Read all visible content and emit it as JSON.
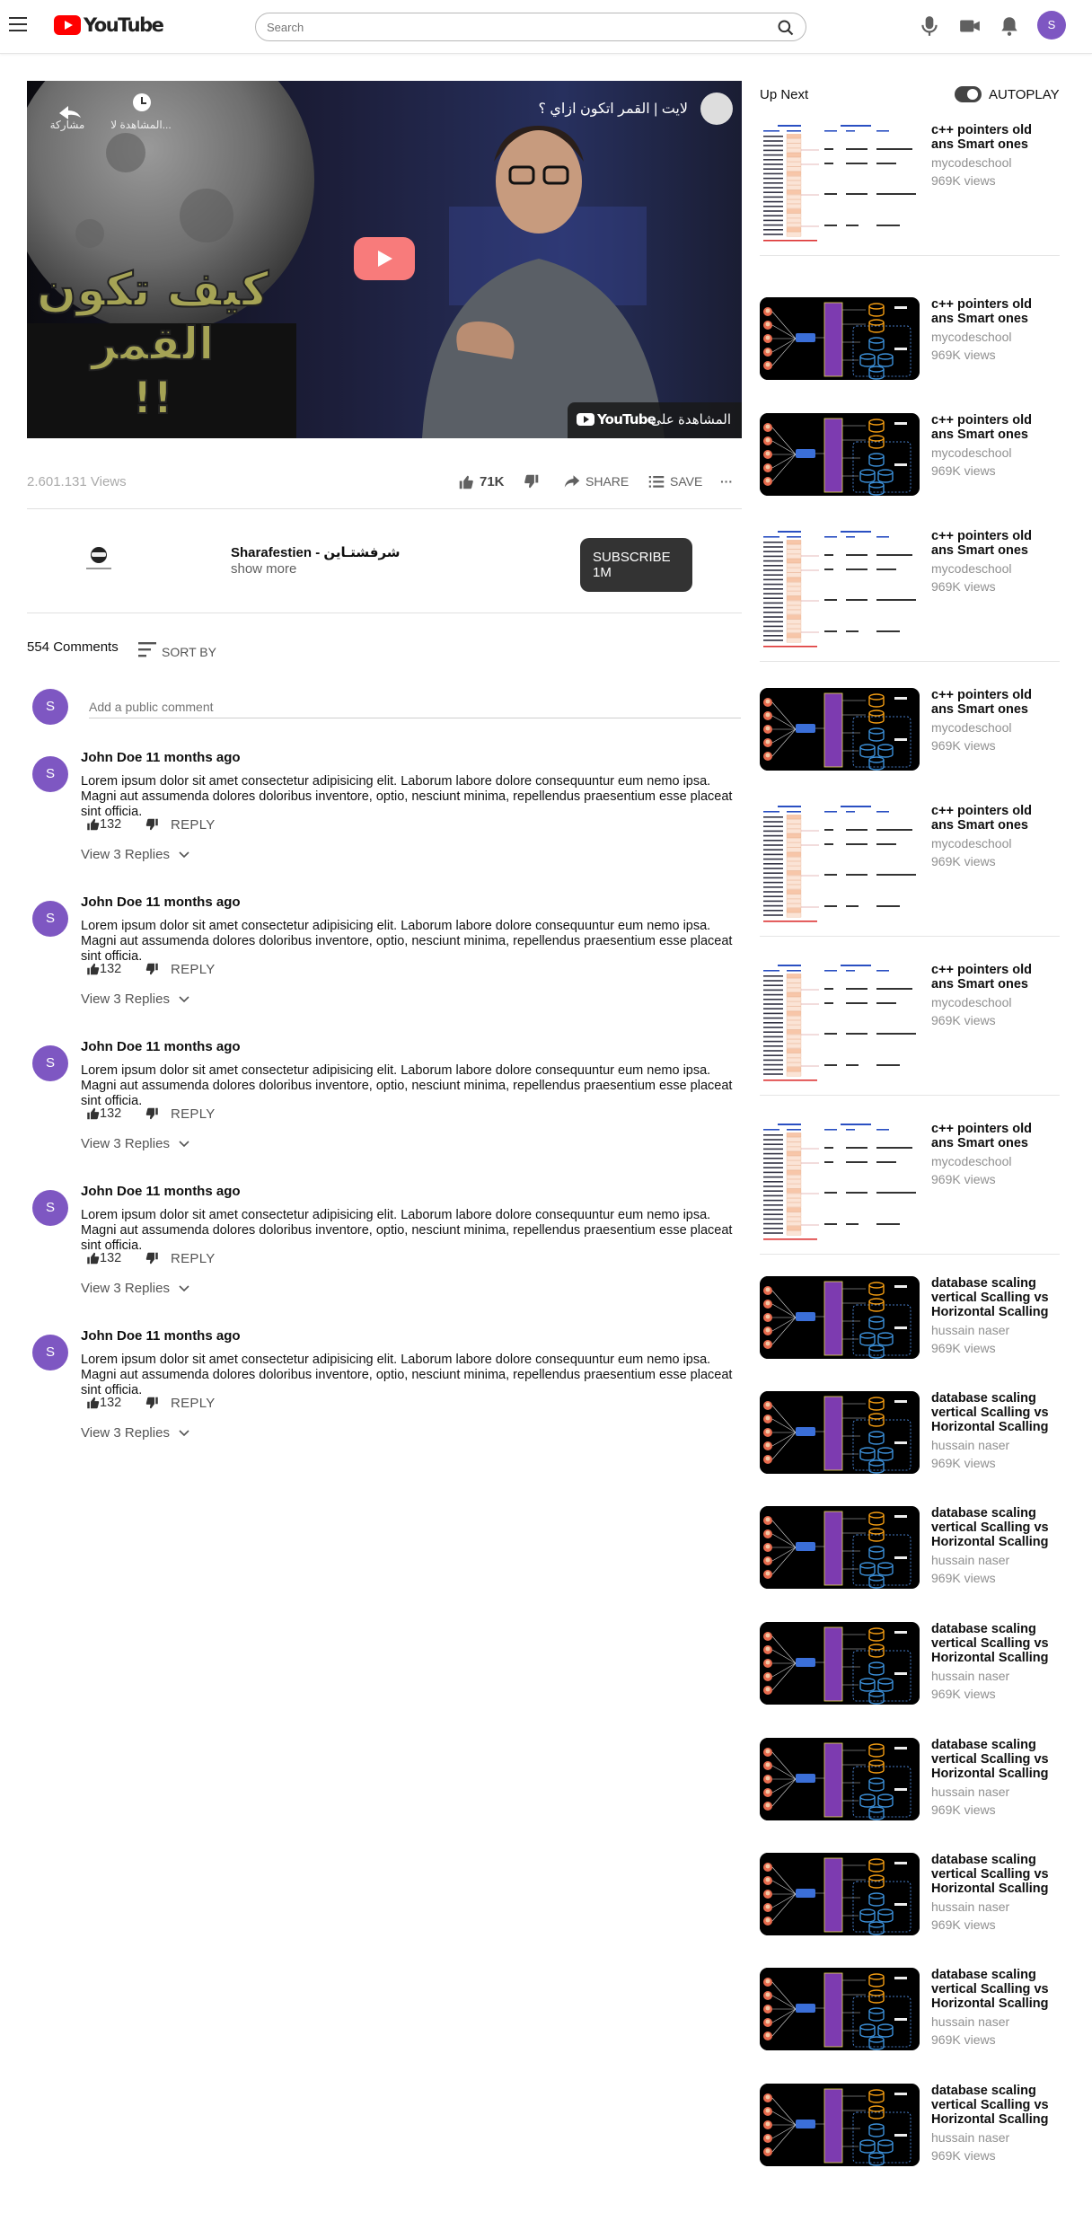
{
  "header": {
    "logo_text": "YouTube",
    "search_placeholder": "Search",
    "avatar_letter": "S"
  },
  "player": {
    "title": "لايت | القمر اتكون ازاي ؟",
    "share_label": "مشاركة",
    "watch_later_label": "المشاهدة لا...",
    "watch_on_label": "المشاهدة على",
    "watch_on_brand": "YouTube",
    "thumbnail_text_line1": "كيف تكون",
    "thumbnail_text_line2": "القمر",
    "thumbnail_text_line3": "!!"
  },
  "stats": {
    "views": "2.601.131 Views",
    "likes": "71K",
    "share_label": "SHARE",
    "save_label": "SAVE",
    "more_label": "···"
  },
  "channel": {
    "name": "Sharafestien - شرفشتـاين",
    "show_more": "show more",
    "subscribe_label": "SUBSCRIBE",
    "subscriber_count": "1M"
  },
  "comments": {
    "count_label": "554 Comments",
    "sort_label": "SORT BY",
    "input_placeholder": "Add a public comment",
    "my_avatar_letter": "S",
    "items": [
      {
        "avatar": "S",
        "author": "John Doe 11 months ago",
        "text": "Lorem ipsum dolor sit amet consectetur adipisicing elit. Laborum labore dolore consequuntur eum nemo ipsa. Magni aut assumenda dolores doloribus inventore, optio, nesciunt minima, repellendus praesentium esse placeat sint officia.",
        "likes": "132",
        "reply": "REPLY",
        "view_replies": "View 3 Replies"
      },
      {
        "avatar": "S",
        "author": "John Doe 11 months ago",
        "text": "Lorem ipsum dolor sit amet consectetur adipisicing elit. Laborum labore dolore consequuntur eum nemo ipsa. Magni aut assumenda dolores doloribus inventore, optio, nesciunt minima, repellendus praesentium esse placeat sint officia.",
        "likes": "132",
        "reply": "REPLY",
        "view_replies": "View 3 Replies"
      },
      {
        "avatar": "S",
        "author": "John Doe 11 months ago",
        "text": "Lorem ipsum dolor sit amet consectetur adipisicing elit. Laborum labore dolore consequuntur eum nemo ipsa. Magni aut assumenda dolores doloribus inventore, optio, nesciunt minima, repellendus praesentium esse placeat sint officia.",
        "likes": "132",
        "reply": "REPLY",
        "view_replies": "View 3 Replies"
      },
      {
        "avatar": "S",
        "author": "John Doe 11 months ago",
        "text": "Lorem ipsum dolor sit amet consectetur adipisicing elit. Laborum labore dolore consequuntur eum nemo ipsa. Magni aut assumenda dolores doloribus inventore, optio, nesciunt minima, repellendus praesentium esse placeat sint officia.",
        "likes": "132",
        "reply": "REPLY",
        "view_replies": "View 3 Replies"
      },
      {
        "avatar": "S",
        "author": "John Doe 11 months ago",
        "text": "Lorem ipsum dolor sit amet consectetur adipisicing elit. Laborum labore dolore consequuntur eum nemo ipsa. Magni aut assumenda dolores doloribus inventore, optio, nesciunt minima, repellendus praesentium esse placeat sint officia.",
        "likes": "132",
        "reply": "REPLY",
        "view_replies": "View 3 Replies"
      }
    ]
  },
  "sidebar": {
    "up_next_label": "Up Next",
    "autoplay_label": "AUTOPLAY",
    "autoplay_on": true,
    "items": [
      {
        "thumb": "memory",
        "title": "c++ pointers old ans Smart ones",
        "channel": "mycodeschool",
        "views": "969K views"
      },
      {
        "thumb": "db",
        "title": "c++ pointers old ans Smart ones",
        "channel": "mycodeschool",
        "views": "969K views"
      },
      {
        "thumb": "db",
        "title": "c++ pointers old ans Smart ones",
        "channel": "mycodeschool",
        "views": "969K views"
      },
      {
        "thumb": "memory",
        "title": "c++ pointers old ans Smart ones",
        "channel": "mycodeschool",
        "views": "969K views"
      },
      {
        "thumb": "db",
        "title": "c++ pointers old ans Smart ones",
        "channel": "mycodeschool",
        "views": "969K views"
      },
      {
        "thumb": "memory",
        "title": "c++ pointers old ans Smart ones",
        "channel": "mycodeschool",
        "views": "969K views"
      },
      {
        "thumb": "memory",
        "title": "c++ pointers old ans Smart ones",
        "channel": "mycodeschool",
        "views": "969K views"
      },
      {
        "thumb": "memory",
        "title": "c++ pointers old ans Smart ones",
        "channel": "mycodeschool",
        "views": "969K views"
      },
      {
        "thumb": "db",
        "title": "database scaling vertical Scalling vs Horizontal Scalling",
        "channel": "hussain naser",
        "views": "969K views"
      },
      {
        "thumb": "db",
        "title": "database scaling vertical Scalling vs Horizontal Scalling",
        "channel": "hussain naser",
        "views": "969K views"
      },
      {
        "thumb": "db",
        "title": "database scaling vertical Scalling vs Horizontal Scalling",
        "channel": "hussain naser",
        "views": "969K views"
      },
      {
        "thumb": "db",
        "title": "database scaling vertical Scalling vs Horizontal Scalling",
        "channel": "hussain naser",
        "views": "969K views"
      },
      {
        "thumb": "db",
        "title": "database scaling vertical Scalling vs Horizontal Scalling",
        "channel": "hussain naser",
        "views": "969K views"
      },
      {
        "thumb": "db",
        "title": "database scaling vertical Scalling vs Horizontal Scalling",
        "channel": "hussain naser",
        "views": "969K views"
      },
      {
        "thumb": "db",
        "title": "database scaling vertical Scalling vs Horizontal Scalling",
        "channel": "hussain naser",
        "views": "969K views"
      },
      {
        "thumb": "db",
        "title": "database scaling vertical Scalling vs Horizontal Scalling",
        "channel": "hussain naser",
        "views": "969K views"
      }
    ]
  },
  "colors": {
    "brand_red": "#ff0000",
    "avatar_purple": "#7e57c2",
    "subscribe_bg": "#333333",
    "play_button": "#f87b7b"
  }
}
